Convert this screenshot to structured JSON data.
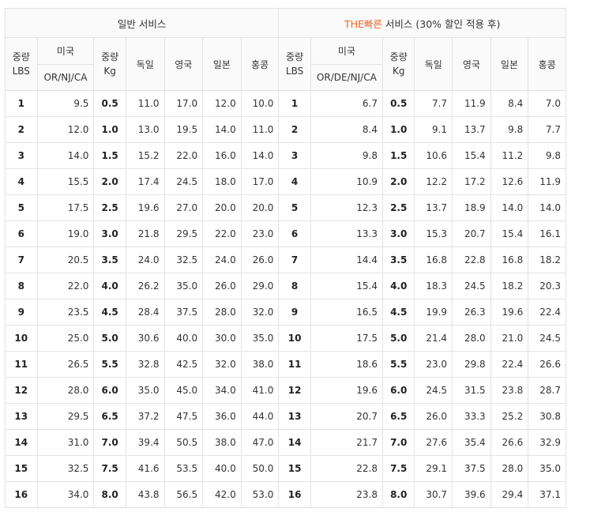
{
  "header": {
    "left_title": "일반 서비스",
    "right_title_accent": "THE빠른",
    "right_title_rest": " 서비스 (30% 할인 적용 후)",
    "col_weight_lbs": [
      "중량",
      "LBS"
    ],
    "col_weight_kg": [
      "중량",
      "Kg"
    ],
    "col_usa": "미국",
    "col_usa_sub_left": "OR/NJ/CA",
    "col_usa_sub_right": "OR/DE/NJ/CA",
    "col_germany": "독일",
    "col_uk": "영국",
    "col_japan": "일본",
    "col_hongkong": "홍콩"
  },
  "accent_color": "#e8632b",
  "rows": [
    {
      "lbs": "1",
      "normal": [
        "9.5",
        "0.5",
        "11.0",
        "17.0",
        "12.0",
        "10.0"
      ],
      "fast": [
        "6.7",
        "0.5",
        "7.7",
        "11.9",
        "8.4",
        "7.0"
      ]
    },
    {
      "lbs": "2",
      "normal": [
        "12.0",
        "1.0",
        "13.0",
        "19.5",
        "14.0",
        "11.0"
      ],
      "fast": [
        "8.4",
        "1.0",
        "9.1",
        "13.7",
        "9.8",
        "7.7"
      ]
    },
    {
      "lbs": "3",
      "normal": [
        "14.0",
        "1.5",
        "15.2",
        "22.0",
        "16.0",
        "14.0"
      ],
      "fast": [
        "9.8",
        "1.5",
        "10.6",
        "15.4",
        "11.2",
        "9.8"
      ]
    },
    {
      "lbs": "4",
      "normal": [
        "15.5",
        "2.0",
        "17.4",
        "24.5",
        "18.0",
        "17.0"
      ],
      "fast": [
        "10.9",
        "2.0",
        "12.2",
        "17.2",
        "12.6",
        "11.9"
      ]
    },
    {
      "lbs": "5",
      "normal": [
        "17.5",
        "2.5",
        "19.6",
        "27.0",
        "20.0",
        "20.0"
      ],
      "fast": [
        "12.3",
        "2.5",
        "13.7",
        "18.9",
        "14.0",
        "14.0"
      ]
    },
    {
      "lbs": "6",
      "normal": [
        "19.0",
        "3.0",
        "21.8",
        "29.5",
        "22.0",
        "23.0"
      ],
      "fast": [
        "13.3",
        "3.0",
        "15.3",
        "20.7",
        "15.4",
        "16.1"
      ]
    },
    {
      "lbs": "7",
      "normal": [
        "20.5",
        "3.5",
        "24.0",
        "32.5",
        "24.0",
        "26.0"
      ],
      "fast": [
        "14.4",
        "3.5",
        "16.8",
        "22.8",
        "16.8",
        "18.2"
      ]
    },
    {
      "lbs": "8",
      "normal": [
        "22.0",
        "4.0",
        "26.2",
        "35.0",
        "26.0",
        "29.0"
      ],
      "fast": [
        "15.4",
        "4.0",
        "18.3",
        "24.5",
        "18.2",
        "20.3"
      ]
    },
    {
      "lbs": "9",
      "normal": [
        "23.5",
        "4.5",
        "28.4",
        "37.5",
        "28.0",
        "32.0"
      ],
      "fast": [
        "16.5",
        "4.5",
        "19.9",
        "26.3",
        "19.6",
        "22.4"
      ]
    },
    {
      "lbs": "10",
      "normal": [
        "25.0",
        "5.0",
        "30.6",
        "40.0",
        "30.0",
        "35.0"
      ],
      "fast": [
        "17.5",
        "5.0",
        "21.4",
        "28.0",
        "21.0",
        "24.5"
      ]
    },
    {
      "lbs": "11",
      "normal": [
        "26.5",
        "5.5",
        "32.8",
        "42.5",
        "32.0",
        "38.0"
      ],
      "fast": [
        "18.6",
        "5.5",
        "23.0",
        "29.8",
        "22.4",
        "26.6"
      ]
    },
    {
      "lbs": "12",
      "normal": [
        "28.0",
        "6.0",
        "35.0",
        "45.0",
        "34.0",
        "41.0"
      ],
      "fast": [
        "19.6",
        "6.0",
        "24.5",
        "31.5",
        "23.8",
        "28.7"
      ]
    },
    {
      "lbs": "13",
      "normal": [
        "29.5",
        "6.5",
        "37.2",
        "47.5",
        "36.0",
        "44.0"
      ],
      "fast": [
        "20.7",
        "6.5",
        "26.0",
        "33.3",
        "25.2",
        "30.8"
      ]
    },
    {
      "lbs": "14",
      "normal": [
        "31.0",
        "7.0",
        "39.4",
        "50.5",
        "38.0",
        "47.0"
      ],
      "fast": [
        "21.7",
        "7.0",
        "27.6",
        "35.4",
        "26.6",
        "32.9"
      ]
    },
    {
      "lbs": "15",
      "normal": [
        "32.5",
        "7.5",
        "41.6",
        "53.5",
        "40.0",
        "50.0"
      ],
      "fast": [
        "22.8",
        "7.5",
        "29.1",
        "37.5",
        "28.0",
        "35.0"
      ]
    },
    {
      "lbs": "16",
      "normal": [
        "34.0",
        "8.0",
        "43.8",
        "56.5",
        "42.0",
        "53.0"
      ],
      "fast": [
        "23.8",
        "8.0",
        "30.7",
        "39.6",
        "29.4",
        "37.1"
      ]
    }
  ]
}
